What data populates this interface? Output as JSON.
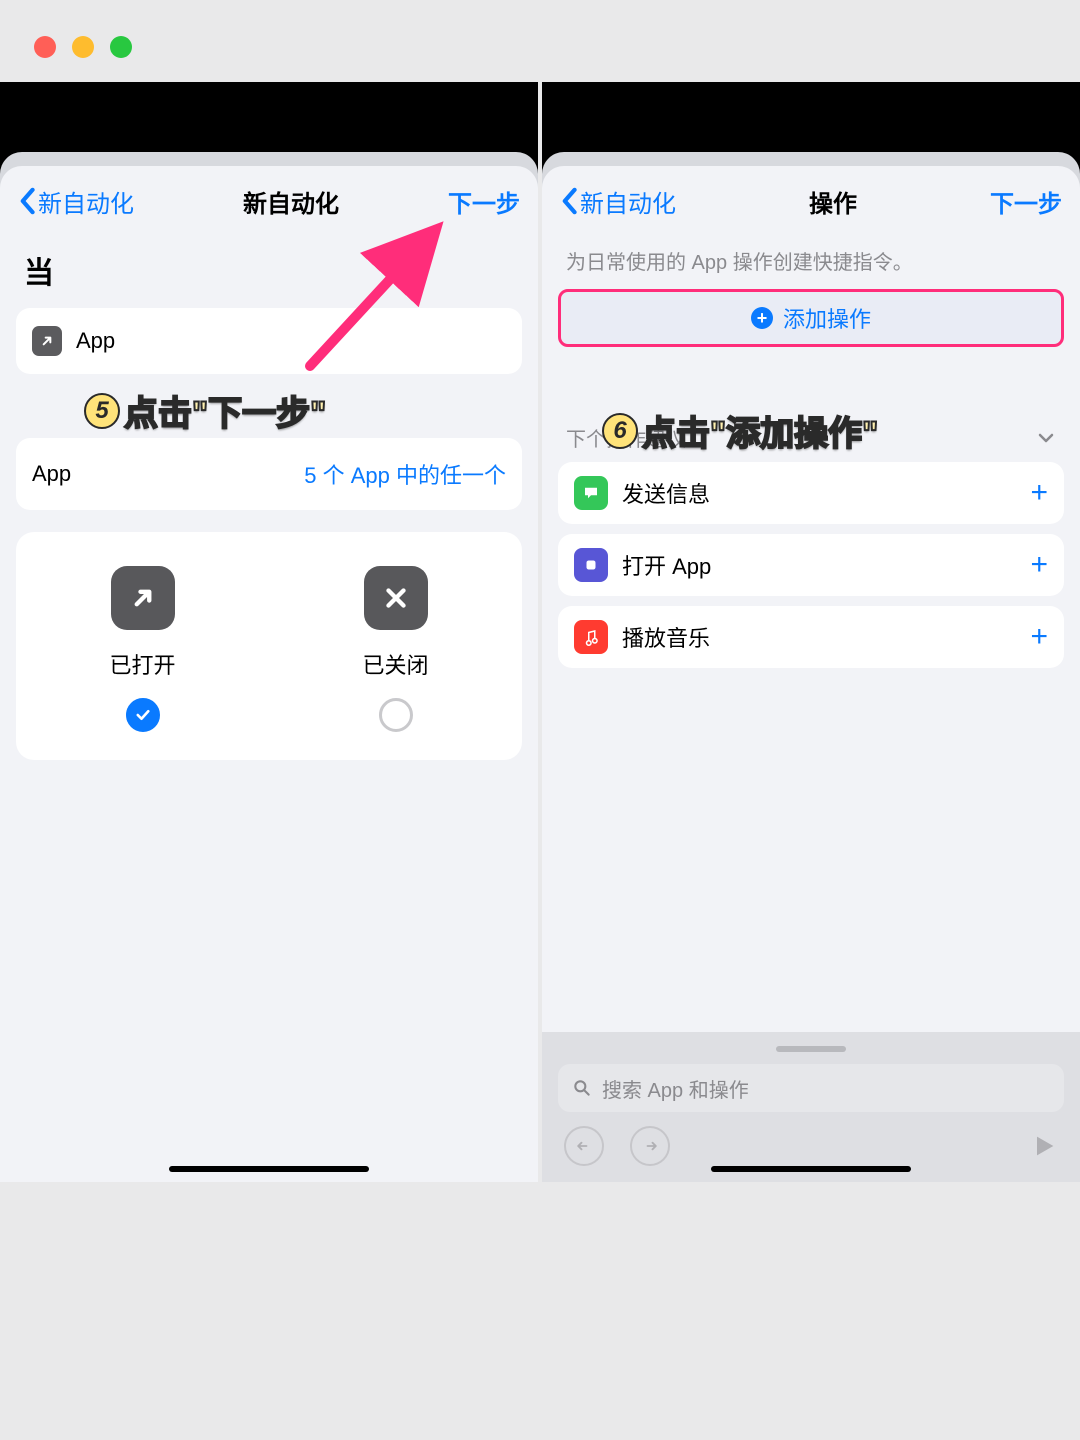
{
  "left": {
    "nav_back": "新自动化",
    "nav_title": "新自动化",
    "nav_next": "下一步",
    "when": "当",
    "app_row": "App",
    "app_label": "App",
    "app_value": "5 个 App 中的任一个",
    "opt_open": "已打开",
    "opt_closed": "已关闭",
    "annotation": "点击\"下一步\"",
    "step_num": "5"
  },
  "right": {
    "nav_back": "新自动化",
    "nav_title": "操作",
    "nav_next": "下一步",
    "subtitle": "为日常使用的 App 操作创建快捷指令。",
    "add_action": "添加操作",
    "sugg_header": "下个操作建议",
    "suggestions": [
      {
        "label": "发送信息"
      },
      {
        "label": "打开 App"
      },
      {
        "label": "播放音乐"
      }
    ],
    "search_placeholder": "搜索 App 和操作",
    "annotation": "点击\"添加操作\"",
    "step_num": "6"
  }
}
